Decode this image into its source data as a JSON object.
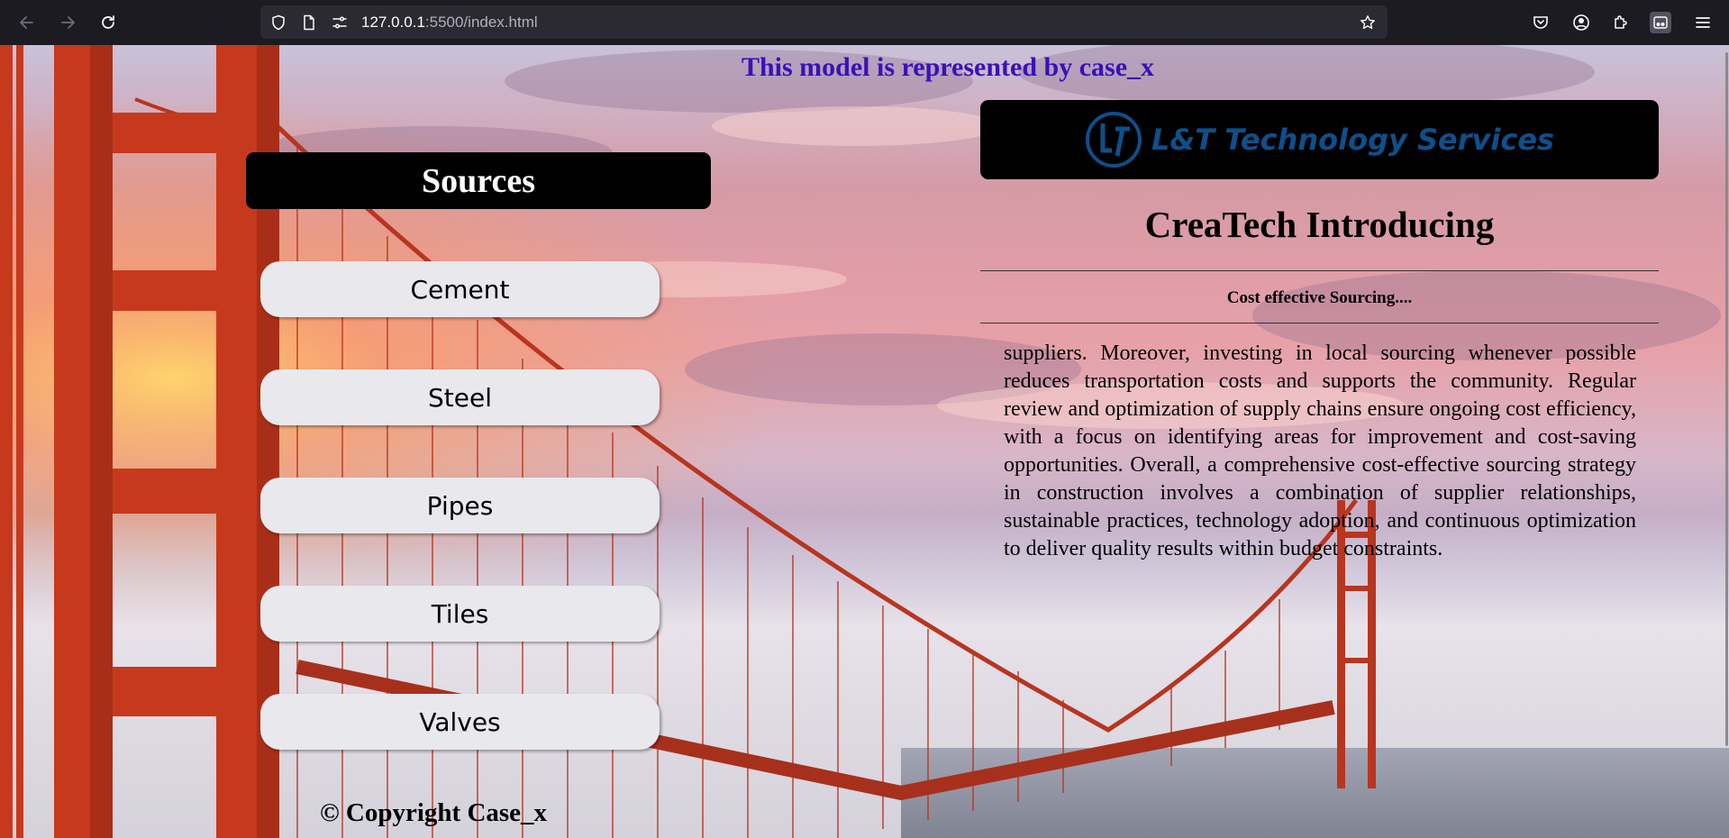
{
  "browser": {
    "url_host": "127.0.0.1",
    "url_path": ":5500/index.html"
  },
  "page": {
    "model_banner": "This model is represented by case_x",
    "sources": {
      "title": "Sources",
      "items": [
        "Cement",
        "Steel",
        "Pipes",
        "Tiles",
        "Valves"
      ]
    },
    "copyright": "© Copyright Case_x",
    "logo": {
      "text": "L&T Technology Services",
      "color": "#0f4f8a"
    },
    "intro": {
      "heading": "CreaTech Introducing",
      "subheading": "Cost effective Sourcing....",
      "body": "suppliers. Moreover, investing in local sourcing whenever possible reduces transportation costs and supports the community. Regular review and optimization of supply chains ensure ongoing cost efficiency, with a focus on identifying areas for improvement and cost-saving opportunities. Overall, a comprehensive cost-effective sourcing strategy in construction involves a combination of supplier relationships, sustainable practices, technology adoption, and continuous optimization to deliver quality results within budget constraints."
    },
    "colors": {
      "banner_text": "#3a11b8",
      "button_bg": "#e9e8ed",
      "title_bg": "#000000"
    }
  }
}
